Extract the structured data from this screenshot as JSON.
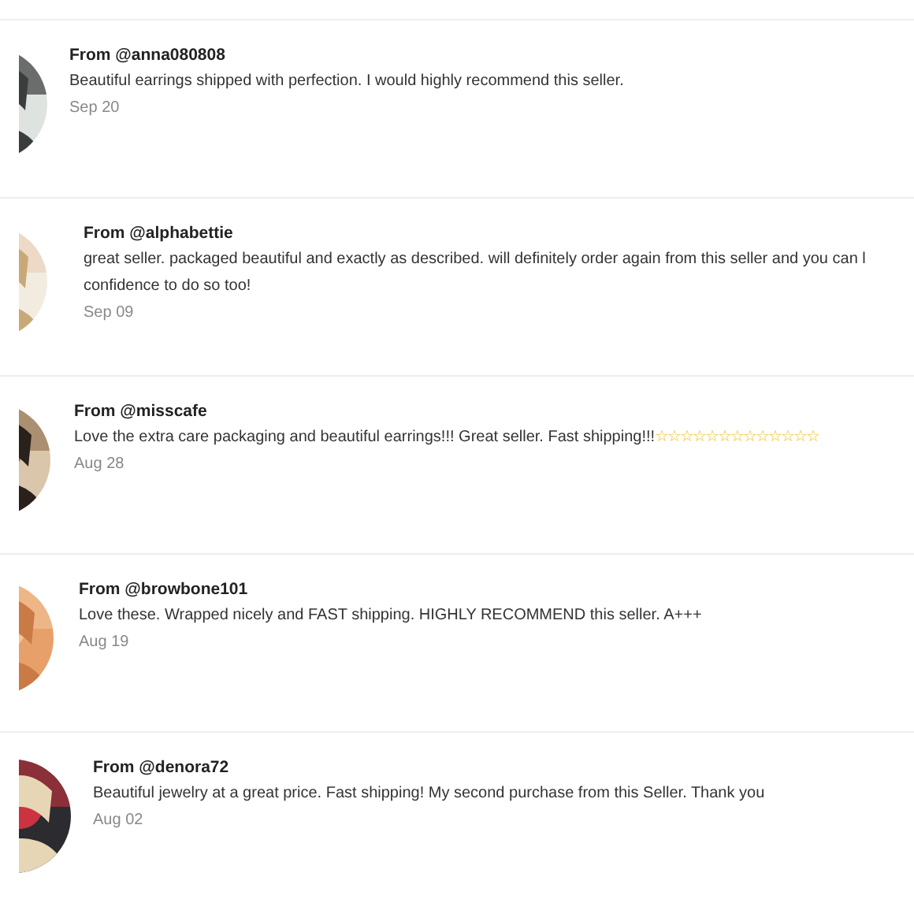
{
  "reviews": [
    {
      "author": "From @anna080808",
      "comment_lines": [
        "Beautiful earrings shipped with perfection. I would highly recommend this seller."
      ],
      "date": "Sep 20"
    },
    {
      "author": "From @alphabettie",
      "comment_lines": [
        "great seller. packaged beautiful and exactly as described. will definitely order again from this seller and you can l",
        "confidence to do so too!"
      ],
      "date": "Sep 09"
    },
    {
      "author": "From @misscafe",
      "comment_lines": [
        "Love the extra care packaging and beautiful earrings!!! Great seller. Fast shipping!!!"
      ],
      "emoji": "☆☆☆☆☆☆☆☆☆☆☆☆☆",
      "date": "Aug 28"
    },
    {
      "author": "From @browbone101",
      "comment_lines": [
        "Love these. Wrapped nicely and FAST shipping. HIGHLY RECOMMEND this seller. A+++"
      ],
      "date": "Aug 19"
    },
    {
      "author": "From @denora72",
      "comment_lines": [
        "Beautiful jewelry at a great price. Fast shipping! My second purchase from this Seller. Thank you"
      ],
      "date": "Aug 02"
    }
  ]
}
